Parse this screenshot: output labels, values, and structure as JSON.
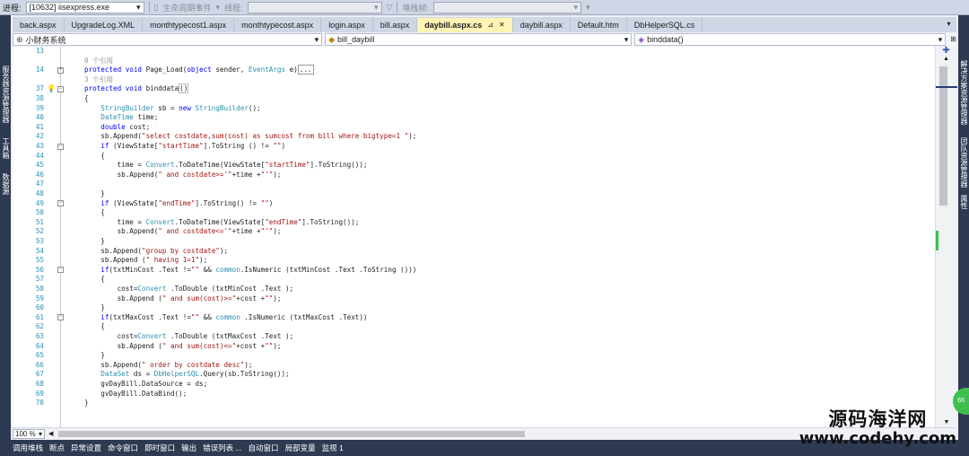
{
  "toolbar": {
    "process_label": "进程:",
    "process_value": "[10632] iisexpress.exe",
    "lifecycle_label": "生命周期事件",
    "thread_label": "线程:",
    "stackframe_label": "堆栈帧:"
  },
  "tabs": [
    {
      "label": "back.aspx"
    },
    {
      "label": "UpgradeLog.XML"
    },
    {
      "label": "monthtypecost1.aspx"
    },
    {
      "label": "monthtypecost.aspx"
    },
    {
      "label": "login.aspx"
    },
    {
      "label": "bill.aspx"
    },
    {
      "label": "daybill.aspx.cs",
      "active": true
    },
    {
      "label": "daybill.aspx"
    },
    {
      "label": "Default.htm"
    },
    {
      "label": "DbHelperSQL.cs"
    }
  ],
  "nav": {
    "project": "小财务系统",
    "class": "bill_daybill",
    "member": "binddata()"
  },
  "left_tool_tabs": [
    "服务器资源管理器",
    "工具箱",
    "数据源"
  ],
  "right_tool_tabs": [
    "解决方案资源管理器",
    "团队资源管理器",
    "属性"
  ],
  "code_lines": [
    {
      "n": "13",
      "code": ""
    },
    {
      "n": "",
      "code": "<span class='gr'>0 个引用</span>"
    },
    {
      "n": "14",
      "code": "<span class='kw'>protected void</span> Page_Load(<span class='kw'>object</span> sender, <span class='ty'>EventArgs</span> e)<span style='border:1px solid #999;padding:0 1px'>...</span>",
      "collapse": "+"
    },
    {
      "n": "",
      "code": "<span class='gr'>3 个引用</span>"
    },
    {
      "n": "37",
      "code": "<span class='kw'>protected void</span> binddata<span style='border:1px solid #bbb'>()</span>",
      "collapse": "-",
      "bulb": true
    },
    {
      "n": "38",
      "code": "{"
    },
    {
      "n": "39",
      "code": "    <span class='ty'>StringBuilder</span> sb = <span class='kw'>new</span> <span class='ty'>StringBuilder</span>();"
    },
    {
      "n": "40",
      "code": "    <span class='ty'>DateTime</span> time;"
    },
    {
      "n": "41",
      "code": "    <span class='kw'>double</span> cost;"
    },
    {
      "n": "42",
      "code": "    sb.Append(<span class='st'>\"select costdate,sum(cost) as sumcost from bill where bigtype=1 \"</span>);"
    },
    {
      "n": "43",
      "code": "    <span class='kw'>if</span> (ViewState[<span class='st'>\"startTime\"</span>].ToString () != <span class='st'>\"\"</span>)",
      "collapse": "-"
    },
    {
      "n": "44",
      "code": "    {"
    },
    {
      "n": "45",
      "code": "        time = <span class='ty'>Convert</span>.ToDateTime(ViewState[<span class='st'>\"startTime\"</span>].ToString());"
    },
    {
      "n": "46",
      "code": "        sb.Append(<span class='st'>\" and costdate&gt;='\"</span>+time +<span class='st'>\"'\"</span>);"
    },
    {
      "n": "47",
      "code": ""
    },
    {
      "n": "48",
      "code": "    }"
    },
    {
      "n": "49",
      "code": "    <span class='kw'>if</span> (ViewState[<span class='st'>\"endTime\"</span>].ToString() != <span class='st'>\"\"</span>)",
      "collapse": "-"
    },
    {
      "n": "50",
      "code": "    {"
    },
    {
      "n": "51",
      "code": "        time = <span class='ty'>Convert</span>.ToDateTime(ViewState[<span class='st'>\"endTime\"</span>].ToString());"
    },
    {
      "n": "52",
      "code": "        sb.Append(<span class='st'>\" and costdate&lt;='\"</span>+time +<span class='st'>\"'\"</span>);"
    },
    {
      "n": "53",
      "code": "    }"
    },
    {
      "n": "54",
      "code": "    sb.Append(<span class='st'>\"group by costdate\"</span>);"
    },
    {
      "n": "55",
      "code": "    sb.Append (<span class='st'>\" having 1=1\"</span>);"
    },
    {
      "n": "56",
      "code": "    <span class='kw'>if</span>(txtMinCost .Text !=<span class='st'>\"\"</span> &amp;&amp; <span class='ty'>common</span>.IsNumeric (txtMinCost .Text .ToString ()))",
      "collapse": "-"
    },
    {
      "n": "57",
      "code": "    {"
    },
    {
      "n": "58",
      "code": "        cost=<span class='ty'>Convert</span> .ToDouble (txtMinCost .Text );"
    },
    {
      "n": "59",
      "code": "        sb.Append (<span class='st'>\" and sum(cost)&gt;=\"</span>+cost +<span class='st'>\"\"</span>);"
    },
    {
      "n": "60",
      "code": "    }"
    },
    {
      "n": "61",
      "code": "    <span class='kw'>if</span>(txtMaxCost .Text !=<span class='st'>\"\"</span> &amp;&amp; <span class='ty'>common</span> .IsNumeric (txtMaxCost .Text))",
      "collapse": "-"
    },
    {
      "n": "62",
      "code": "    {"
    },
    {
      "n": "63",
      "code": "        cost=<span class='ty'>Convert</span> .ToDouble (txtMaxCost .Text );"
    },
    {
      "n": "64",
      "code": "        sb.Append (<span class='st'>\" and sum(cost)&lt;=\"</span>+cost +<span class='st'>\"\"</span>);"
    },
    {
      "n": "65",
      "code": "    }"
    },
    {
      "n": "66",
      "code": "    sb.Append(<span class='st'>\" order by costdate desc\"</span>);"
    },
    {
      "n": "67",
      "code": "    <span class='ty'>DataSet</span> ds = <span class='ty'>DbHelperSQL</span>.Query(sb.ToString());"
    },
    {
      "n": "68",
      "code": "    gvDayBill.DataSource = ds;"
    },
    {
      "n": "69",
      "code": "    gvDayBill.DataBind();"
    },
    {
      "n": "70",
      "code": "}"
    }
  ],
  "zoom": "100 %",
  "status_items": [
    "调用堆栈",
    "断点",
    "异常设置",
    "命令窗口",
    "即时窗口",
    "输出",
    "错误列表 ...",
    "自动窗口",
    "局部变量",
    "监视 1"
  ],
  "watermark": {
    "line1": "源码海洋网",
    "line2": "www.codehy.com"
  },
  "badge": "65"
}
